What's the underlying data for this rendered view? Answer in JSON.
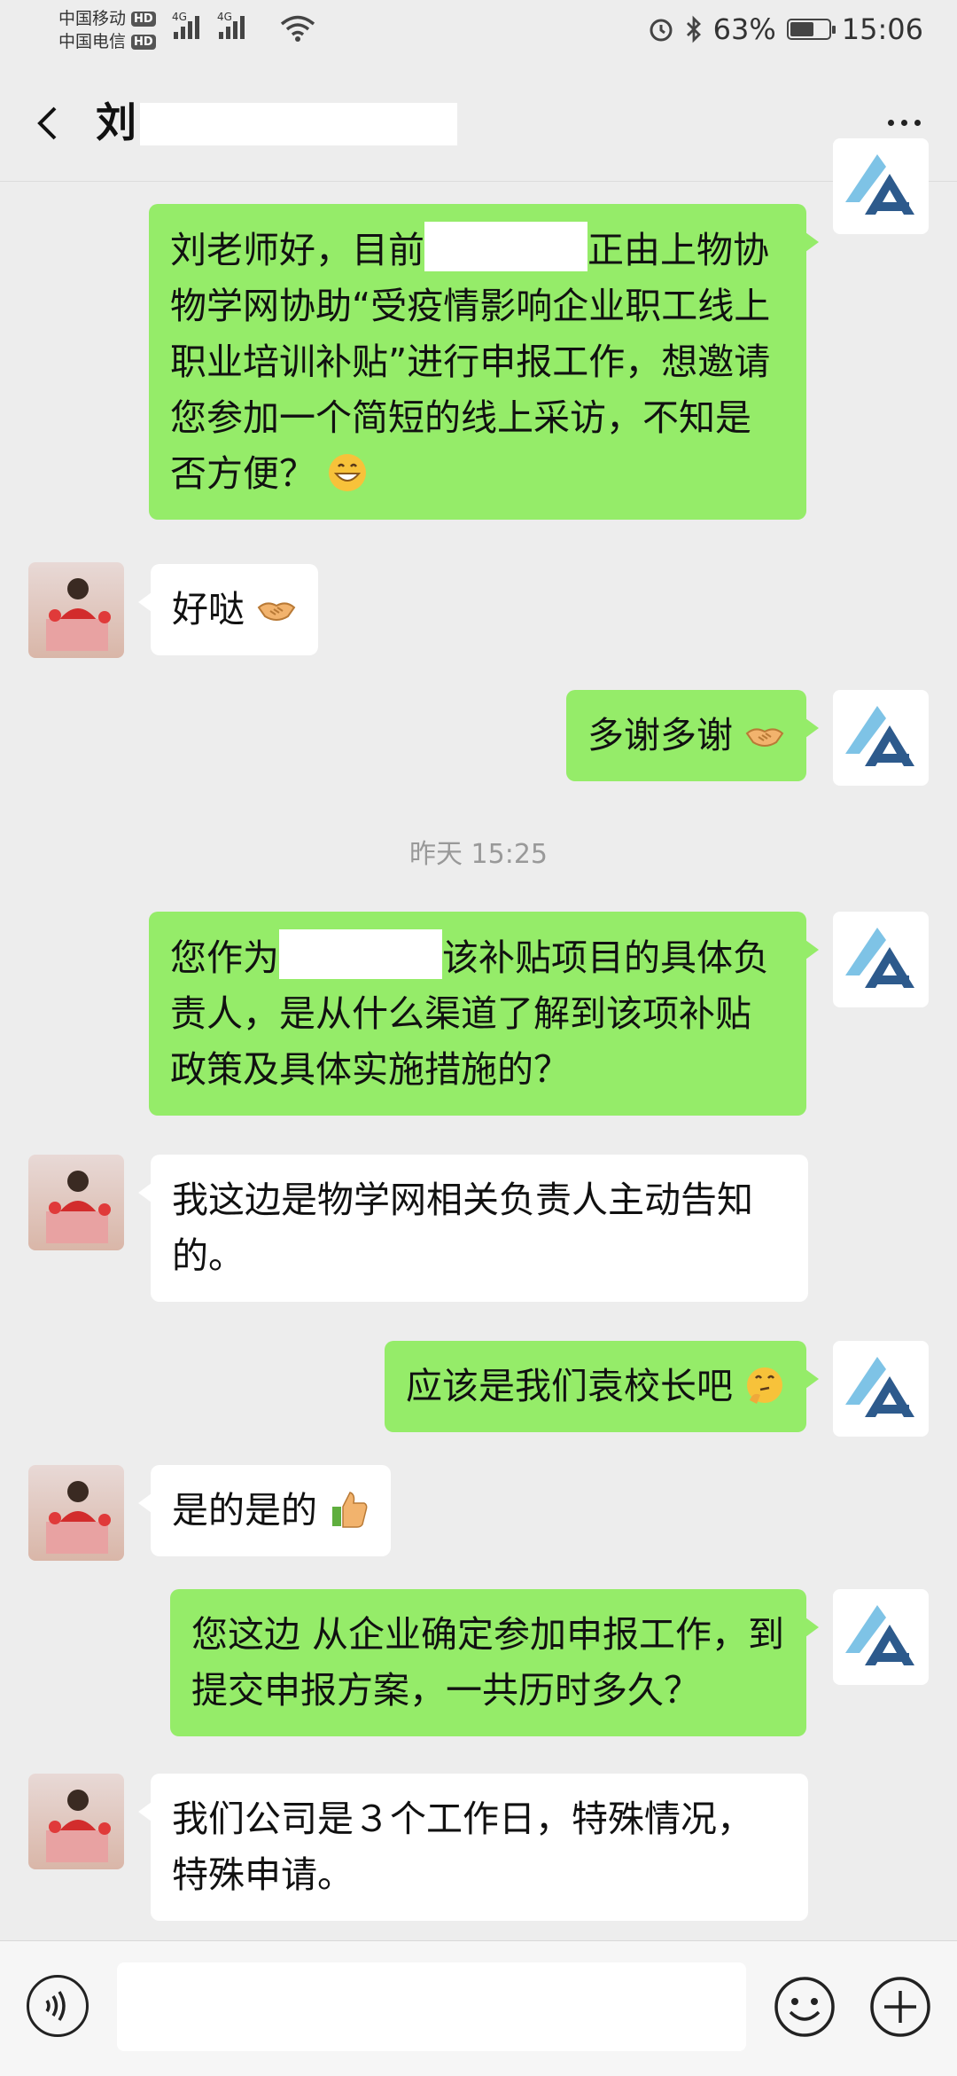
{
  "status_bar": {
    "carrier1": "中国移动",
    "carrier2": "中国电信",
    "hd": "HD",
    "net1": "4G",
    "net2": "4G",
    "battery_pct": "63%",
    "battery_level": 0.63,
    "time": "15:06"
  },
  "header": {
    "title": "刘"
  },
  "messages": [
    {
      "from": "me",
      "pre": "刘老师好，目前",
      "post": "正由上物协物学网协助“受疫情影响企业职工线上职业培训补贴”进行申报工作，想邀请您参加一个简短的线上采访，不知是否方便？",
      "emoji": "grin-emoji"
    },
    {
      "from": "them",
      "text": "好哒",
      "emoji": "handshake-emoji"
    },
    {
      "from": "me",
      "text": "多谢多谢",
      "emoji": "handshake-emoji"
    },
    {
      "from": "me",
      "pre": "您作为",
      "post": "该补贴项目的具体负责人，是从什么渠道了解到该项补贴政策及具体实施措施的？"
    },
    {
      "from": "them",
      "text": "我这边是物学网相关负责人主动告知的。"
    },
    {
      "from": "me",
      "text": "应该是我们袁校长吧",
      "emoji": "thinking-emoji"
    },
    {
      "from": "them",
      "text": "是的是的",
      "emoji": "thumbs-up-emoji"
    },
    {
      "from": "me",
      "text": "您这边 从企业确定参加申报工作，到提交申报方案，一共历时多久？"
    },
    {
      "from": "them",
      "text": "我们公司是３个工作日，特殊情况，特殊申请。"
    }
  ],
  "timestamp": "昨天 15:25",
  "input_bar": {
    "placeholder": "",
    "left_icon": "voice-icon",
    "right_icons": [
      "emoji-icon",
      "plus-icon"
    ]
  },
  "colors": {
    "background": "#ededed",
    "my_bubble": "#95ec69",
    "their_bubble": "#ffffff"
  }
}
